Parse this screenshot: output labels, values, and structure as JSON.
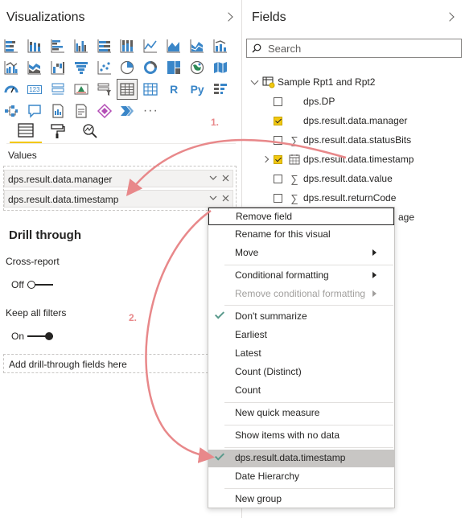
{
  "visualizations": {
    "title": "Visualizations",
    "icons": [
      [
        "stacked-bar-chart-icon",
        "stacked-column-chart-icon",
        "clustered-bar-chart-icon",
        "clustered-column-chart-icon",
        "stacked-bar-100-icon",
        "column-100-icon",
        "line-chart-icon",
        "area-chart-icon",
        "stacked-area-chart-icon",
        "line-stacked-column-icon"
      ],
      [
        "line-clustered-column-icon",
        "ribbon-chart-icon",
        "waterfall-chart-icon",
        "funnel-chart-icon",
        "scatter-chart-icon",
        "pie-chart-icon",
        "donut-chart-icon",
        "treemap-icon",
        "map-icon",
        "filled-map-icon"
      ],
      [
        "gauge-icon",
        "card-icon",
        "multi-row-card-icon",
        "kpi-icon",
        "slicer-icon",
        "table-icon",
        "matrix-icon",
        "r-visual-icon",
        "python-visual-icon",
        "key-influencers-icon"
      ],
      [
        "decomposition-tree-icon",
        "qa-icon",
        "smart-narrative-icon",
        "paginated-report-icon",
        "power-apps-icon",
        "power-automate-icon",
        "more-visuals-icon"
      ]
    ],
    "r_label": "R",
    "py_label": "Py",
    "card_label": "123",
    "more_label": "···",
    "values_label": "Values",
    "values_fields": [
      "dps.result.data.manager",
      "dps.result.data.timestamp"
    ],
    "drill_through": {
      "title": "Drill through",
      "cross_report_label": "Cross-report",
      "cross_report_state": "Off",
      "keep_filters_label": "Keep all filters",
      "keep_filters_state": "On",
      "add_placeholder": "Add drill-through fields here"
    }
  },
  "fields": {
    "title": "Fields",
    "search_placeholder": "Search",
    "table_name": "Sample Rpt1 and Rpt2",
    "items": [
      {
        "name": "dps.DP",
        "type": "",
        "checked": false
      },
      {
        "name": "dps.result.data.manager",
        "type": "",
        "checked": true
      },
      {
        "name": "dps.result.data.statusBits",
        "type": "sigma",
        "checked": false
      },
      {
        "name": "dps.result.data.timestamp",
        "type": "calendar",
        "checked": true
      },
      {
        "name": "dps.result.data.value",
        "type": "sigma",
        "checked": false
      },
      {
        "name": "dps.result.returnCode",
        "type": "sigma",
        "checked": false
      },
      {
        "name": "age",
        "type": "",
        "checked": false
      }
    ]
  },
  "context_menu": {
    "items": [
      {
        "label": "Remove field"
      },
      {
        "label": "Rename for this visual"
      },
      {
        "label": "Move"
      },
      {
        "label": "Conditional formatting"
      },
      {
        "label": "Remove conditional formatting"
      },
      {
        "label": "Don't summarize"
      },
      {
        "label": "Earliest"
      },
      {
        "label": "Latest"
      },
      {
        "label": "Count (Distinct)"
      },
      {
        "label": "Count"
      },
      {
        "label": "New quick measure"
      },
      {
        "label": "Show items with no data"
      },
      {
        "label": "dps.result.data.timestamp"
      },
      {
        "label": "Date Hierarchy"
      },
      {
        "label": "New group"
      }
    ]
  },
  "annotations": {
    "step1": "1.",
    "step2": "2.",
    "arrow_color": "#e8888a"
  },
  "colors": {
    "accent_yellow": "#f2c811",
    "check_green": "#5a9a8c",
    "highlight_gray": "#c8c6c4"
  }
}
